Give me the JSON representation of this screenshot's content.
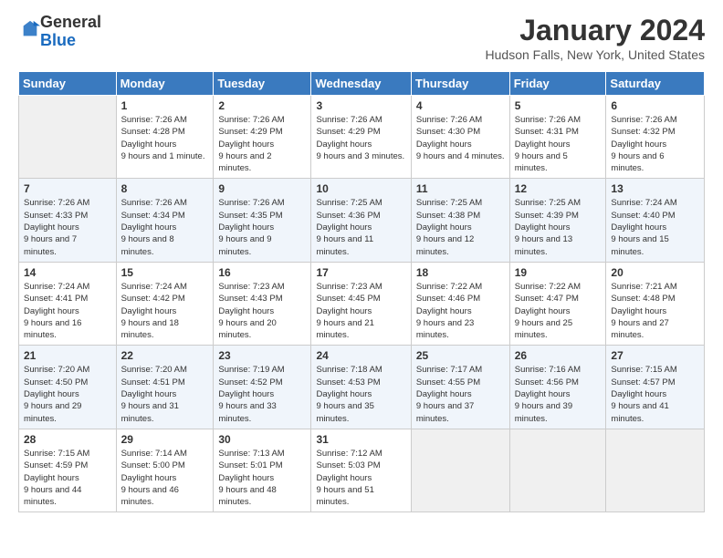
{
  "logo": {
    "general": "General",
    "blue": "Blue"
  },
  "header": {
    "title": "January 2024",
    "location": "Hudson Falls, New York, United States"
  },
  "days_of_week": [
    "Sunday",
    "Monday",
    "Tuesday",
    "Wednesday",
    "Thursday",
    "Friday",
    "Saturday"
  ],
  "weeks": [
    [
      {
        "day": "",
        "empty": true
      },
      {
        "day": "1",
        "sunrise": "7:26 AM",
        "sunset": "4:28 PM",
        "daylight": "9 hours and 1 minute."
      },
      {
        "day": "2",
        "sunrise": "7:26 AM",
        "sunset": "4:29 PM",
        "daylight": "9 hours and 2 minutes."
      },
      {
        "day": "3",
        "sunrise": "7:26 AM",
        "sunset": "4:29 PM",
        "daylight": "9 hours and 3 minutes."
      },
      {
        "day": "4",
        "sunrise": "7:26 AM",
        "sunset": "4:30 PM",
        "daylight": "9 hours and 4 minutes."
      },
      {
        "day": "5",
        "sunrise": "7:26 AM",
        "sunset": "4:31 PM",
        "daylight": "9 hours and 5 minutes."
      },
      {
        "day": "6",
        "sunrise": "7:26 AM",
        "sunset": "4:32 PM",
        "daylight": "9 hours and 6 minutes."
      }
    ],
    [
      {
        "day": "7",
        "sunrise": "7:26 AM",
        "sunset": "4:33 PM",
        "daylight": "9 hours and 7 minutes."
      },
      {
        "day": "8",
        "sunrise": "7:26 AM",
        "sunset": "4:34 PM",
        "daylight": "9 hours and 8 minutes."
      },
      {
        "day": "9",
        "sunrise": "7:26 AM",
        "sunset": "4:35 PM",
        "daylight": "9 hours and 9 minutes."
      },
      {
        "day": "10",
        "sunrise": "7:25 AM",
        "sunset": "4:36 PM",
        "daylight": "9 hours and 11 minutes."
      },
      {
        "day": "11",
        "sunrise": "7:25 AM",
        "sunset": "4:38 PM",
        "daylight": "9 hours and 12 minutes."
      },
      {
        "day": "12",
        "sunrise": "7:25 AM",
        "sunset": "4:39 PM",
        "daylight": "9 hours and 13 minutes."
      },
      {
        "day": "13",
        "sunrise": "7:24 AM",
        "sunset": "4:40 PM",
        "daylight": "9 hours and 15 minutes."
      }
    ],
    [
      {
        "day": "14",
        "sunrise": "7:24 AM",
        "sunset": "4:41 PM",
        "daylight": "9 hours and 16 minutes."
      },
      {
        "day": "15",
        "sunrise": "7:24 AM",
        "sunset": "4:42 PM",
        "daylight": "9 hours and 18 minutes."
      },
      {
        "day": "16",
        "sunrise": "7:23 AM",
        "sunset": "4:43 PM",
        "daylight": "9 hours and 20 minutes."
      },
      {
        "day": "17",
        "sunrise": "7:23 AM",
        "sunset": "4:45 PM",
        "daylight": "9 hours and 21 minutes."
      },
      {
        "day": "18",
        "sunrise": "7:22 AM",
        "sunset": "4:46 PM",
        "daylight": "9 hours and 23 minutes."
      },
      {
        "day": "19",
        "sunrise": "7:22 AM",
        "sunset": "4:47 PM",
        "daylight": "9 hours and 25 minutes."
      },
      {
        "day": "20",
        "sunrise": "7:21 AM",
        "sunset": "4:48 PM",
        "daylight": "9 hours and 27 minutes."
      }
    ],
    [
      {
        "day": "21",
        "sunrise": "7:20 AM",
        "sunset": "4:50 PM",
        "daylight": "9 hours and 29 minutes."
      },
      {
        "day": "22",
        "sunrise": "7:20 AM",
        "sunset": "4:51 PM",
        "daylight": "9 hours and 31 minutes."
      },
      {
        "day": "23",
        "sunrise": "7:19 AM",
        "sunset": "4:52 PM",
        "daylight": "9 hours and 33 minutes."
      },
      {
        "day": "24",
        "sunrise": "7:18 AM",
        "sunset": "4:53 PM",
        "daylight": "9 hours and 35 minutes."
      },
      {
        "day": "25",
        "sunrise": "7:17 AM",
        "sunset": "4:55 PM",
        "daylight": "9 hours and 37 minutes."
      },
      {
        "day": "26",
        "sunrise": "7:16 AM",
        "sunset": "4:56 PM",
        "daylight": "9 hours and 39 minutes."
      },
      {
        "day": "27",
        "sunrise": "7:15 AM",
        "sunset": "4:57 PM",
        "daylight": "9 hours and 41 minutes."
      }
    ],
    [
      {
        "day": "28",
        "sunrise": "7:15 AM",
        "sunset": "4:59 PM",
        "daylight": "9 hours and 44 minutes."
      },
      {
        "day": "29",
        "sunrise": "7:14 AM",
        "sunset": "5:00 PM",
        "daylight": "9 hours and 46 minutes."
      },
      {
        "day": "30",
        "sunrise": "7:13 AM",
        "sunset": "5:01 PM",
        "daylight": "9 hours and 48 minutes."
      },
      {
        "day": "31",
        "sunrise": "7:12 AM",
        "sunset": "5:03 PM",
        "daylight": "9 hours and 51 minutes."
      },
      {
        "day": "",
        "empty": true
      },
      {
        "day": "",
        "empty": true
      },
      {
        "day": "",
        "empty": true
      }
    ]
  ],
  "labels": {
    "sunrise": "Sunrise:",
    "sunset": "Sunset:",
    "daylight": "Daylight hours"
  }
}
